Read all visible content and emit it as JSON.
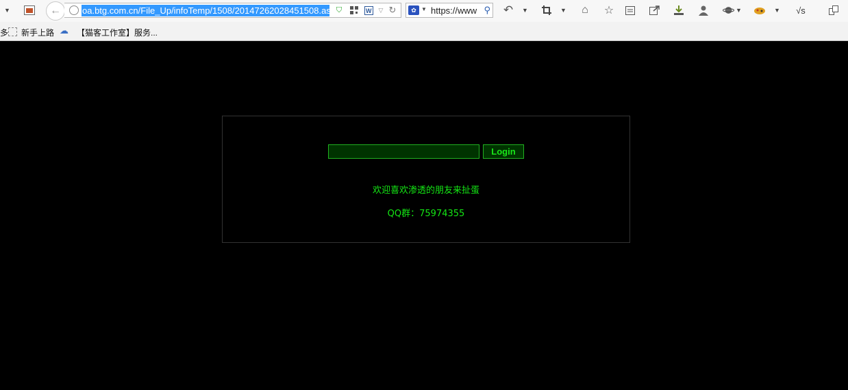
{
  "browser": {
    "url": "oa.btg.com.cn/File_Up/infoTemp/1508/20147262028451508.as",
    "search_value": "https://www",
    "bookmarks": [
      "新手上路",
      "【猫客工作室】服务..."
    ]
  },
  "page": {
    "password_value": "",
    "login_label": "Login",
    "welcome_text": "欢迎喜欢渗透的朋友来扯蛋",
    "qq_text": "QQ群：75974355"
  },
  "colors": {
    "page_bg": "#000000",
    "text_green": "#14e614",
    "input_bg": "#003300",
    "box_border": "#333333"
  }
}
